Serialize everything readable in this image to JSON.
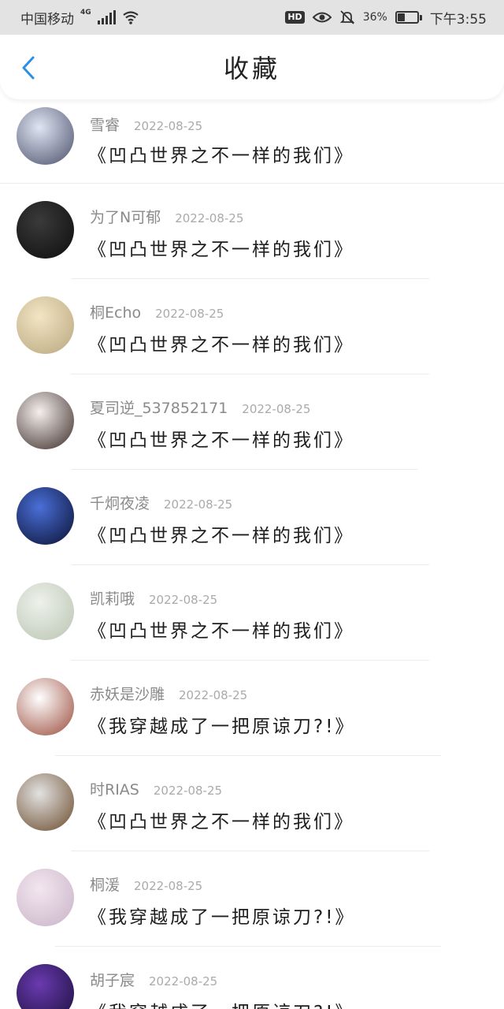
{
  "status_bar": {
    "carrier": "中国移动",
    "network": "4G",
    "hd_badge": "HD",
    "battery_text": "36%",
    "battery_level": 0.36,
    "time": "下午3:55"
  },
  "header": {
    "title": "收藏"
  },
  "items": [
    {
      "username": "雪睿",
      "date": "2022-08-25",
      "book": "《凹凸世界之不一样的我们》",
      "avatar_colors": [
        "#dfe5f2",
        "#4a4f6a"
      ]
    },
    {
      "username": "为了N可郁",
      "date": "2022-08-25",
      "book": "《凹凸世界之不一样的我们》",
      "avatar_colors": [
        "#3a3a3a",
        "#0d0d0d"
      ]
    },
    {
      "username": "桐Echo",
      "date": "2022-08-25",
      "book": "《凹凸世界之不一样的我们》",
      "avatar_colors": [
        "#f3e5c4",
        "#b7a77e"
      ]
    },
    {
      "username": "夏司逆_537852171",
      "date": "2022-08-25",
      "book": "《凹凸世界之不一样的我们》",
      "avatar_colors": [
        "#f4f0ee",
        "#3b2a26"
      ]
    },
    {
      "username": "千炯夜凌",
      "date": "2022-08-25",
      "book": "《凹凸世界之不一样的我们》",
      "avatar_colors": [
        "#4a6fd8",
        "#0a1030"
      ]
    },
    {
      "username": "凯莉哦",
      "date": "2022-08-25",
      "book": "《凹凸世界之不一样的我们》",
      "avatar_colors": [
        "#eef1ea",
        "#b9c4b2"
      ]
    },
    {
      "username": "赤妖是沙雕",
      "date": "2022-08-25",
      "book": "《我穿越成了一把原谅刀?!》",
      "avatar_colors": [
        "#ffffff",
        "#9a4a3a"
      ]
    },
    {
      "username": "时RIAS",
      "date": "2022-08-25",
      "book": "《凹凸世界之不一样的我们》",
      "avatar_colors": [
        "#e2e2e2",
        "#6a4a2a"
      ]
    },
    {
      "username": "桐湲",
      "date": "2022-08-25",
      "book": "《我穿越成了一把原谅刀?!》",
      "avatar_colors": [
        "#f3e6ef",
        "#c8b3c8"
      ]
    },
    {
      "username": "胡子宸",
      "date": "2022-08-25",
      "book": "《我穿越成了一把原谅刀?!》",
      "avatar_colors": [
        "#6a3ab0",
        "#1a0f3a"
      ]
    }
  ]
}
